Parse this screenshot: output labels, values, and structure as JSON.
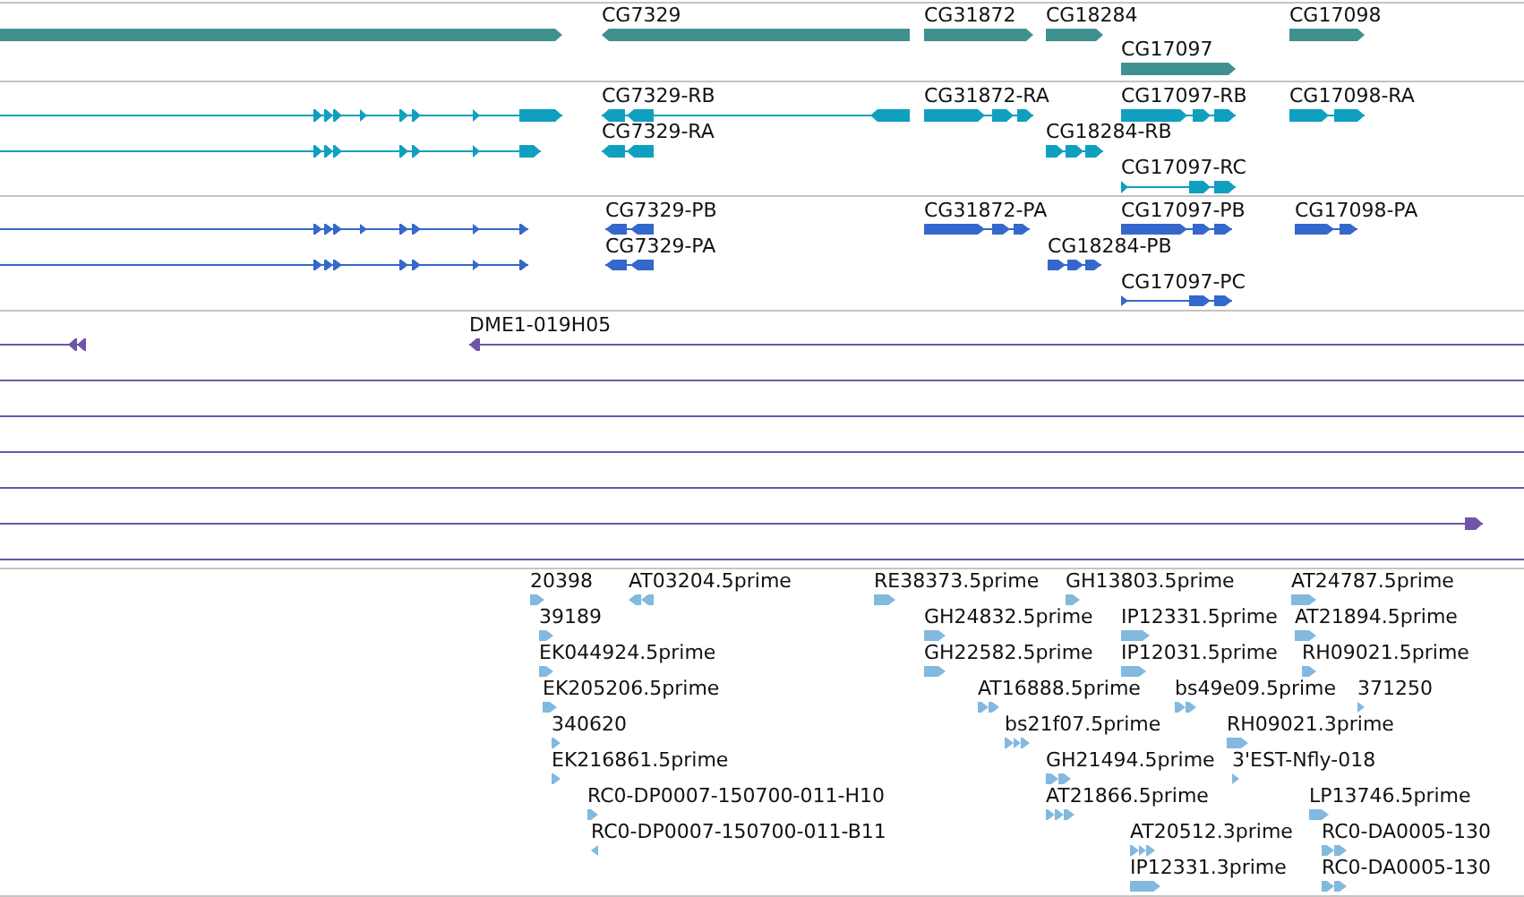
{
  "tracks": [
    {
      "kind": "gene",
      "color": "#3f9190",
      "features": [
        {
          "reverse": false
        },
        {
          "label": "CG7329",
          "reverse": true
        },
        {
          "label": "CG31872",
          "reverse": false
        },
        {
          "label": "CG18284",
          "reverse": false
        },
        {
          "label": "CG17098",
          "reverse": false
        },
        {
          "label": "CG17097",
          "reverse": false
        }
      ]
    },
    {
      "kind": "transcript",
      "color": "#0fa0c0",
      "features": [
        {
          "reverse": false
        },
        {
          "reverse": false
        },
        {
          "label": "CG7329-RB",
          "reverse": true
        },
        {
          "label": "CG31872-RA",
          "reverse": false
        },
        {
          "label": "CG17097-RB",
          "reverse": false
        },
        {
          "label": "CG17098-RA",
          "reverse": false
        },
        {
          "label": "CG7329-RA",
          "reverse": true
        },
        {
          "label": "CG18284-RB",
          "reverse": false
        },
        {
          "label": "CG17097-RC",
          "reverse": false
        }
      ]
    },
    {
      "kind": "protein",
      "color": "#3468cc",
      "features": [
        {
          "reverse": false
        },
        {
          "reverse": false
        },
        {
          "label": "CG7329-PB",
          "reverse": true
        },
        {
          "label": "CG31872-PA",
          "reverse": false
        },
        {
          "label": "CG17097-PB",
          "reverse": false
        },
        {
          "label": "CG17098-PA",
          "reverse": false
        },
        {
          "label": "CG7329-PA",
          "reverse": true
        },
        {
          "label": "CG18284-PB",
          "reverse": false
        },
        {
          "label": "CG17097-PC",
          "reverse": false
        }
      ]
    },
    {
      "kind": "clone",
      "color": "#6f55a8",
      "features": [
        {
          "kind": "arrow",
          "reverse": true
        },
        {
          "kind": "arrow",
          "label": "DME1-019H05",
          "reverse": true
        },
        {
          "kind": "line"
        },
        {
          "kind": "line"
        },
        {
          "kind": "line"
        },
        {
          "kind": "line"
        },
        {
          "kind": "arrow",
          "reverse": false
        },
        {
          "kind": "line"
        }
      ]
    },
    {
      "kind": "est",
      "color": "#82b9df",
      "features": [
        {
          "label": "20398",
          "reverse": false
        },
        {
          "label": "AT03204.5prime",
          "reverse": true
        },
        {
          "label": "RE38373.5prime",
          "reverse": false
        },
        {
          "label": "GH13803.5prime",
          "reverse": false
        },
        {
          "label": "AT24787.5prime",
          "reverse": false
        },
        {
          "label": "39189",
          "reverse": false
        },
        {
          "label": "GH24832.5prime",
          "reverse": false
        },
        {
          "label": "IP12331.5prime",
          "reverse": false
        },
        {
          "label": "AT21894.5prime",
          "reverse": false
        },
        {
          "label": "EK044924.5prime",
          "reverse": false
        },
        {
          "label": "GH22582.5prime",
          "reverse": false
        },
        {
          "label": "IP12031.5prime",
          "reverse": false
        },
        {
          "label": "RH09021.5prime",
          "reverse": false
        },
        {
          "label": "EK205206.5prime",
          "reverse": false
        },
        {
          "label": "AT16888.5prime",
          "reverse": false
        },
        {
          "label": "bs49e09.5prime",
          "reverse": false
        },
        {
          "label": "371250",
          "reverse": false
        },
        {
          "label": "340620",
          "reverse": false
        },
        {
          "label": "bs21f07.5prime",
          "reverse": false
        },
        {
          "label": "RH09021.3prime",
          "reverse": false
        },
        {
          "label": "EK216861.5prime",
          "reverse": false
        },
        {
          "label": "GH21494.5prime",
          "reverse": false
        },
        {
          "label": "3'EST-Nfly-018",
          "reverse": false
        },
        {
          "label": "RC0-DP0007-150700-011-H10",
          "reverse": false
        },
        {
          "label": "AT21866.5prime",
          "reverse": false
        },
        {
          "label": "LP13746.5prime",
          "reverse": false
        },
        {
          "label": "RC0-DP0007-150700-011-B11",
          "reverse": true
        },
        {
          "label": "AT20512.3prime",
          "reverse": false
        },
        {
          "label": "RC0-DA0005-130",
          "reverse": false
        },
        {
          "label": "IP12331.3prime",
          "reverse": false
        },
        {
          "label": "RC0-DA0005-130",
          "reverse": false
        }
      ]
    }
  ]
}
